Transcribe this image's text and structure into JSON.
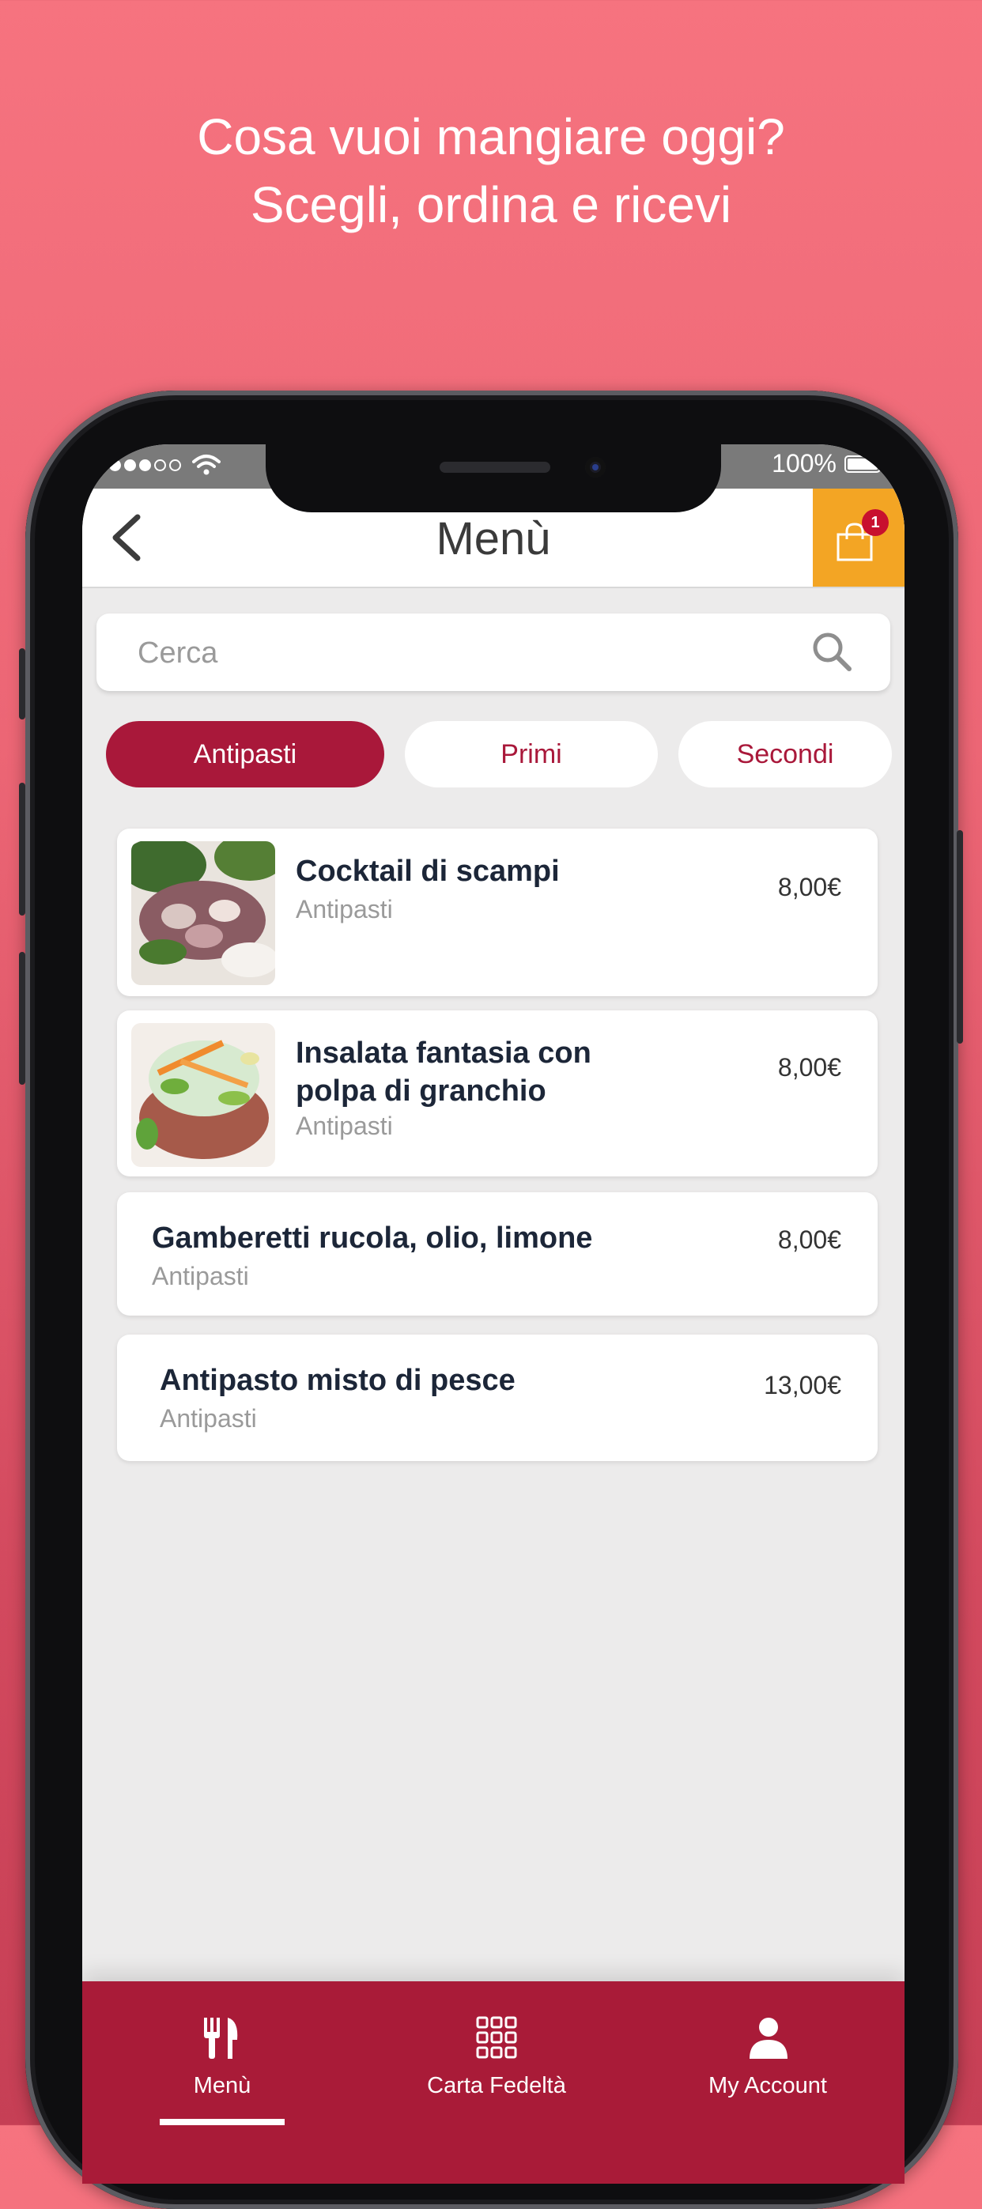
{
  "promo": {
    "line1": "Cosa vuoi mangiare oggi?",
    "line2": "Scegli, ordina e ricevi"
  },
  "status_bar": {
    "battery": "100%"
  },
  "header": {
    "title": "Menù",
    "cart_count": "1"
  },
  "search": {
    "placeholder": "Cerca"
  },
  "categories": [
    {
      "label": "Antipasti",
      "selected": true
    },
    {
      "label": "Primi",
      "selected": false
    },
    {
      "label": "Secondi",
      "selected": false
    }
  ],
  "items": [
    {
      "name": "Cocktail di scampi",
      "category": "Antipasti",
      "price": "8,00€"
    },
    {
      "name": "Insalata fantasia con polpa di granchio",
      "category": "Antipasti",
      "price": "8,00€"
    },
    {
      "name": "Gamberetti rucola, olio, limone",
      "category": "Antipasti",
      "price": "8,00€"
    },
    {
      "name": "Antipasto misto di pesce",
      "category": "Antipasti",
      "price": "13,00€"
    }
  ],
  "tabbar": [
    {
      "label": "Menù",
      "icon": "cutlery-icon",
      "active": true
    },
    {
      "label": "Carta Fedeltà",
      "icon": "grid-icon",
      "active": false
    },
    {
      "label": "My Account",
      "icon": "user-icon",
      "active": false
    }
  ],
  "colors": {
    "primary": "#a9183a",
    "accent": "#f3a524",
    "badge": "#c8102e",
    "background_top": "#f6737f"
  }
}
